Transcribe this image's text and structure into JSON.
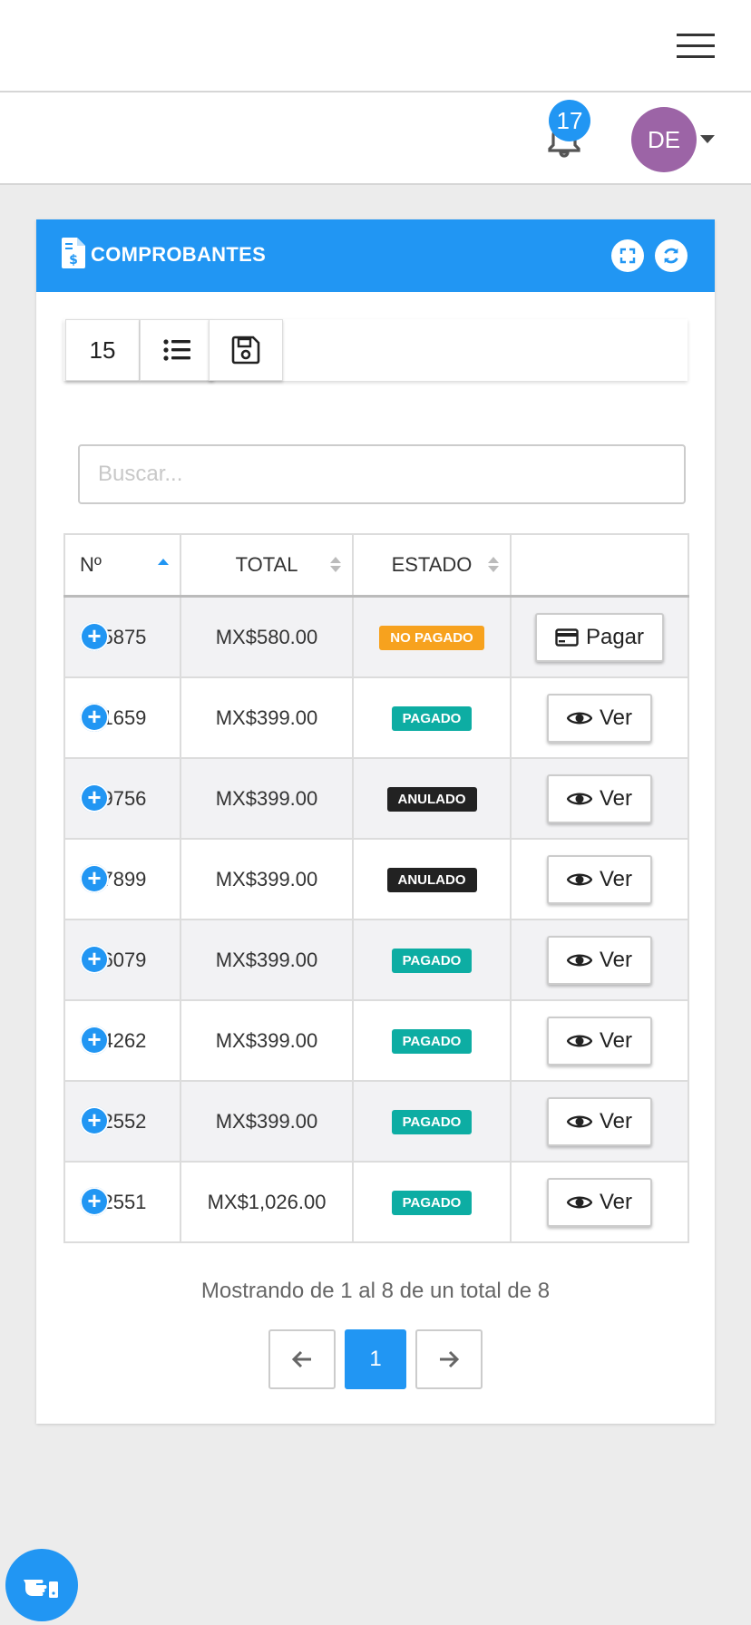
{
  "header": {
    "notifications_count": "17",
    "user_initials": "DE"
  },
  "card": {
    "title": "COMPROBANTES",
    "toolbar": {
      "page_size": "15"
    },
    "search_placeholder": "Buscar..."
  },
  "table": {
    "columns": [
      "Nº",
      "TOTAL",
      "ESTADO",
      ""
    ],
    "rows": [
      {
        "number": "065875",
        "total": "MX$580.00",
        "status": "NO PAGADO",
        "action": "Pagar"
      },
      {
        "number": "051659",
        "total": "MX$399.00",
        "status": "PAGADO",
        "action": "Ver"
      },
      {
        "number": "049756",
        "total": "MX$399.00",
        "status": "ANULADO",
        "action": "Ver"
      },
      {
        "number": "047899",
        "total": "MX$399.00",
        "status": "ANULADO",
        "action": "Ver"
      },
      {
        "number": "046079",
        "total": "MX$399.00",
        "status": "PAGADO",
        "action": "Ver"
      },
      {
        "number": "044262",
        "total": "MX$399.00",
        "status": "PAGADO",
        "action": "Ver"
      },
      {
        "number": "042552",
        "total": "MX$399.00",
        "status": "PAGADO",
        "action": "Ver"
      },
      {
        "number": "042551",
        "total": "MX$1,026.00",
        "status": "PAGADO",
        "action": "Ver"
      }
    ]
  },
  "pagination": {
    "info": "Mostrando de 1 al 8 de un total de 8",
    "current_page": "1"
  },
  "colors": {
    "primary": "#2196f3",
    "status_no_pagado": "#f7a21e",
    "status_pagado": "#0dada3",
    "status_anulado": "#222222",
    "avatar": "#9c64a6"
  }
}
